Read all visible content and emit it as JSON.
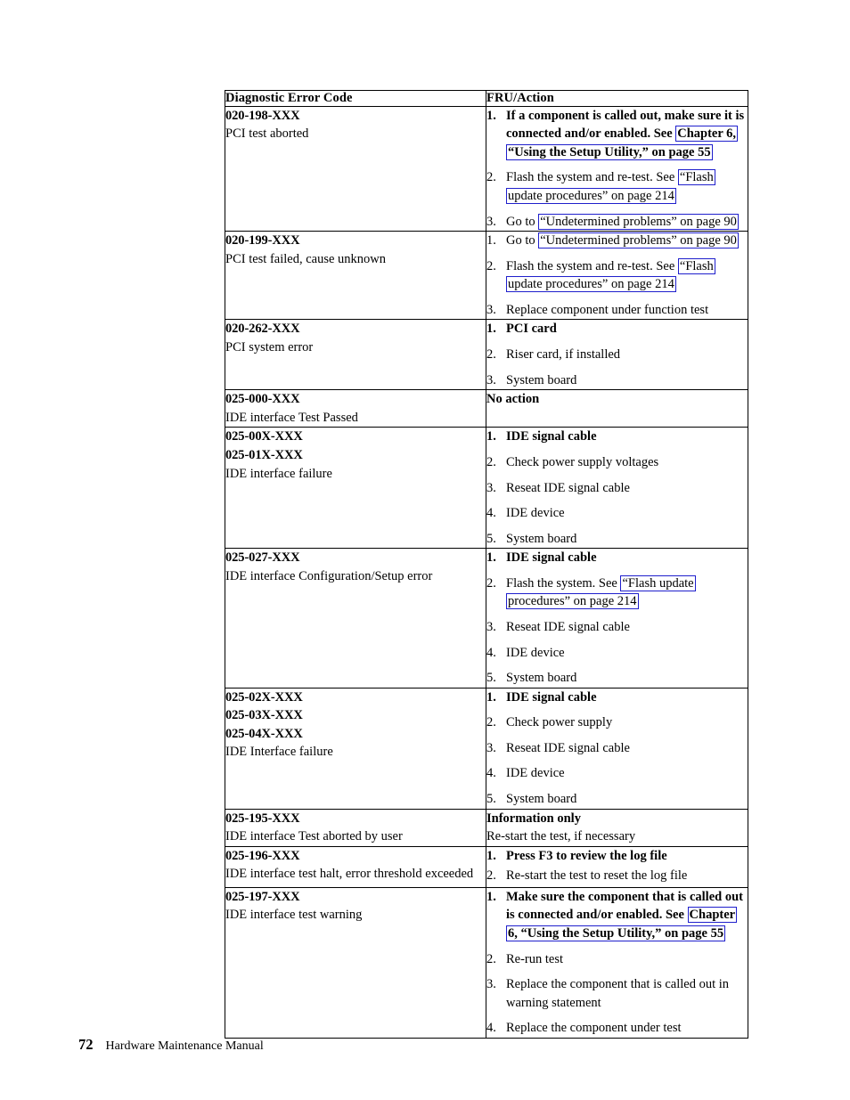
{
  "page": {
    "number": "72",
    "footer_title": "Hardware Maintenance Manual"
  },
  "link_color": "#1f1fcc",
  "table": {
    "headers": {
      "code": "Diagnostic Error Code",
      "fru": "FRU/Action"
    },
    "rows": [
      {
        "codes": [
          "020-198-XXX"
        ],
        "desc": "PCI test aborted",
        "actions": [
          {
            "bold": true,
            "segments": [
              {
                "text": "If a component is called out, make sure it is connected and/or enabled. See ",
                "link": false
              },
              {
                "text": "Chapter 6, “Using the Setup Utility,” on page 55",
                "link": true
              }
            ]
          },
          {
            "bold": false,
            "segments": [
              {
                "text": "Flash the system and re-test. See ",
                "link": false
              },
              {
                "text": "“Flash update procedures” on page 214",
                "link": true
              }
            ]
          },
          {
            "bold": false,
            "segments": [
              {
                "text": "Go to ",
                "link": false
              },
              {
                "text": "“Undetermined problems” on page 90",
                "link": true
              }
            ]
          }
        ]
      },
      {
        "codes": [
          "020-199-XXX"
        ],
        "desc": "PCI test failed, cause unknown",
        "actions": [
          {
            "bold": false,
            "segments": [
              {
                "text": "Go to ",
                "link": false
              },
              {
                "text": "“Undetermined problems” on page 90",
                "link": true
              }
            ]
          },
          {
            "bold": false,
            "segments": [
              {
                "text": "Flash the system and re-test. See ",
                "link": false
              },
              {
                "text": "“Flash update procedures” on page 214",
                "link": true
              }
            ]
          },
          {
            "bold": false,
            "segments": [
              {
                "text": "Replace component under function test",
                "link": false
              }
            ]
          }
        ]
      },
      {
        "codes": [
          "020-262-XXX"
        ],
        "desc": "PCI system error",
        "actions": [
          {
            "bold": true,
            "segments": [
              {
                "text": "PCI card",
                "link": false
              }
            ]
          },
          {
            "bold": false,
            "segments": [
              {
                "text": "Riser card, if installed",
                "link": false
              }
            ]
          },
          {
            "bold": false,
            "segments": [
              {
                "text": "System board",
                "link": false
              }
            ]
          }
        ]
      },
      {
        "codes": [
          "025-000-XXX"
        ],
        "desc": "IDE interface Test Passed",
        "plain": [
          {
            "text": "No action",
            "bold": true
          }
        ]
      },
      {
        "codes": [
          "025-00X-XXX",
          "025-01X-XXX"
        ],
        "desc": "IDE interface failure",
        "actions": [
          {
            "bold": true,
            "segments": [
              {
                "text": "IDE signal cable",
                "link": false
              }
            ]
          },
          {
            "bold": false,
            "segments": [
              {
                "text": "Check power supply voltages",
                "link": false
              }
            ]
          },
          {
            "bold": false,
            "segments": [
              {
                "text": "Reseat IDE signal cable",
                "link": false
              }
            ]
          },
          {
            "bold": false,
            "segments": [
              {
                "text": "IDE device",
                "link": false
              }
            ]
          },
          {
            "bold": false,
            "segments": [
              {
                "text": "System board",
                "link": false
              }
            ]
          }
        ]
      },
      {
        "codes": [
          "025-027-XXX"
        ],
        "desc": "IDE interface Configuration/Setup error",
        "actions": [
          {
            "bold": true,
            "segments": [
              {
                "text": "IDE signal cable",
                "link": false
              }
            ]
          },
          {
            "bold": false,
            "segments": [
              {
                "text": "Flash the system. See ",
                "link": false
              },
              {
                "text": "“Flash update procedures” on page 214",
                "link": true
              }
            ]
          },
          {
            "bold": false,
            "segments": [
              {
                "text": "Reseat IDE signal cable",
                "link": false
              }
            ]
          },
          {
            "bold": false,
            "segments": [
              {
                "text": "IDE device",
                "link": false
              }
            ]
          },
          {
            "bold": false,
            "segments": [
              {
                "text": "System board",
                "link": false
              }
            ]
          }
        ]
      },
      {
        "codes": [
          "025-02X-XXX",
          "025-03X-XXX",
          "025-04X-XXX"
        ],
        "desc": "IDE Interface failure",
        "actions": [
          {
            "bold": true,
            "segments": [
              {
                "text": "IDE signal cable",
                "link": false
              }
            ]
          },
          {
            "bold": false,
            "segments": [
              {
                "text": "Check power supply",
                "link": false
              }
            ]
          },
          {
            "bold": false,
            "segments": [
              {
                "text": "Reseat IDE signal cable",
                "link": false
              }
            ]
          },
          {
            "bold": false,
            "segments": [
              {
                "text": "IDE device",
                "link": false
              }
            ]
          },
          {
            "bold": false,
            "segments": [
              {
                "text": "System board",
                "link": false
              }
            ]
          }
        ]
      },
      {
        "codes": [
          "025-195-XXX"
        ],
        "desc": "IDE interface Test aborted by user",
        "plain": [
          {
            "text": "Information only",
            "bold": true
          },
          {
            "text": "Re-start the test, if necessary",
            "bold": false
          }
        ]
      },
      {
        "codes": [
          "025-196-XXX"
        ],
        "desc": "IDE interface test halt, error threshold exceeded",
        "tight": true,
        "actions": [
          {
            "bold": true,
            "segments": [
              {
                "text": "Press F3 to review the log file",
                "link": false
              }
            ]
          },
          {
            "bold": false,
            "segments": [
              {
                "text": "Re-start the test to reset the log file",
                "link": false
              }
            ]
          }
        ]
      },
      {
        "codes": [
          "025-197-XXX"
        ],
        "desc": "IDE interface test warning",
        "actions": [
          {
            "bold": true,
            "segments": [
              {
                "text": "Make sure the component that is called out is connected and/or enabled. See ",
                "link": false
              },
              {
                "text": "Chapter 6, “Using the Setup Utility,” on page 55",
                "link": true
              }
            ]
          },
          {
            "bold": false,
            "segments": [
              {
                "text": "Re-run test",
                "link": false
              }
            ]
          },
          {
            "bold": false,
            "segments": [
              {
                "text": "Replace the component that is called out in warning statement",
                "link": false
              }
            ]
          },
          {
            "bold": false,
            "segments": [
              {
                "text": "Replace the component under test",
                "link": false
              }
            ]
          }
        ]
      }
    ]
  }
}
